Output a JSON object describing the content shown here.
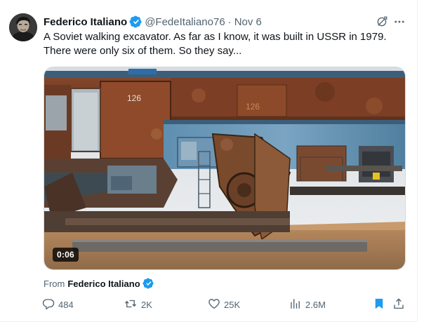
{
  "author": {
    "display_name": "Federico Italiano",
    "handle": "@FedeItaliano76",
    "time": "Nov 6",
    "verified": true
  },
  "tweet": {
    "text_line1": "A Soviet walking excavator. As far as I know, it was built in USSR in 1979.",
    "text_line2": "There were only six of them. So they say..."
  },
  "media": {
    "type": "video",
    "duration": "0:06",
    "machine_number": "126"
  },
  "attribution": {
    "prefix": "From",
    "name": "Federico Italiano"
  },
  "actions": {
    "replies": "484",
    "retweets": "2K",
    "likes": "25K",
    "views": "2.6M"
  },
  "colors": {
    "verified_blue": "#1d9bf0",
    "bookmark_blue": "#1d9bf0",
    "secondary_text": "#536471",
    "primary_text": "#0f1419"
  },
  "icons": {
    "avatar": "user-avatar",
    "verified": "verified-badge-icon",
    "grok": "grok-icon",
    "more": "more-icon",
    "reply": "reply-icon",
    "retweet": "retweet-icon",
    "like": "heart-icon",
    "views": "analytics-icon",
    "bookmark": "bookmark-icon",
    "share": "share-icon"
  }
}
